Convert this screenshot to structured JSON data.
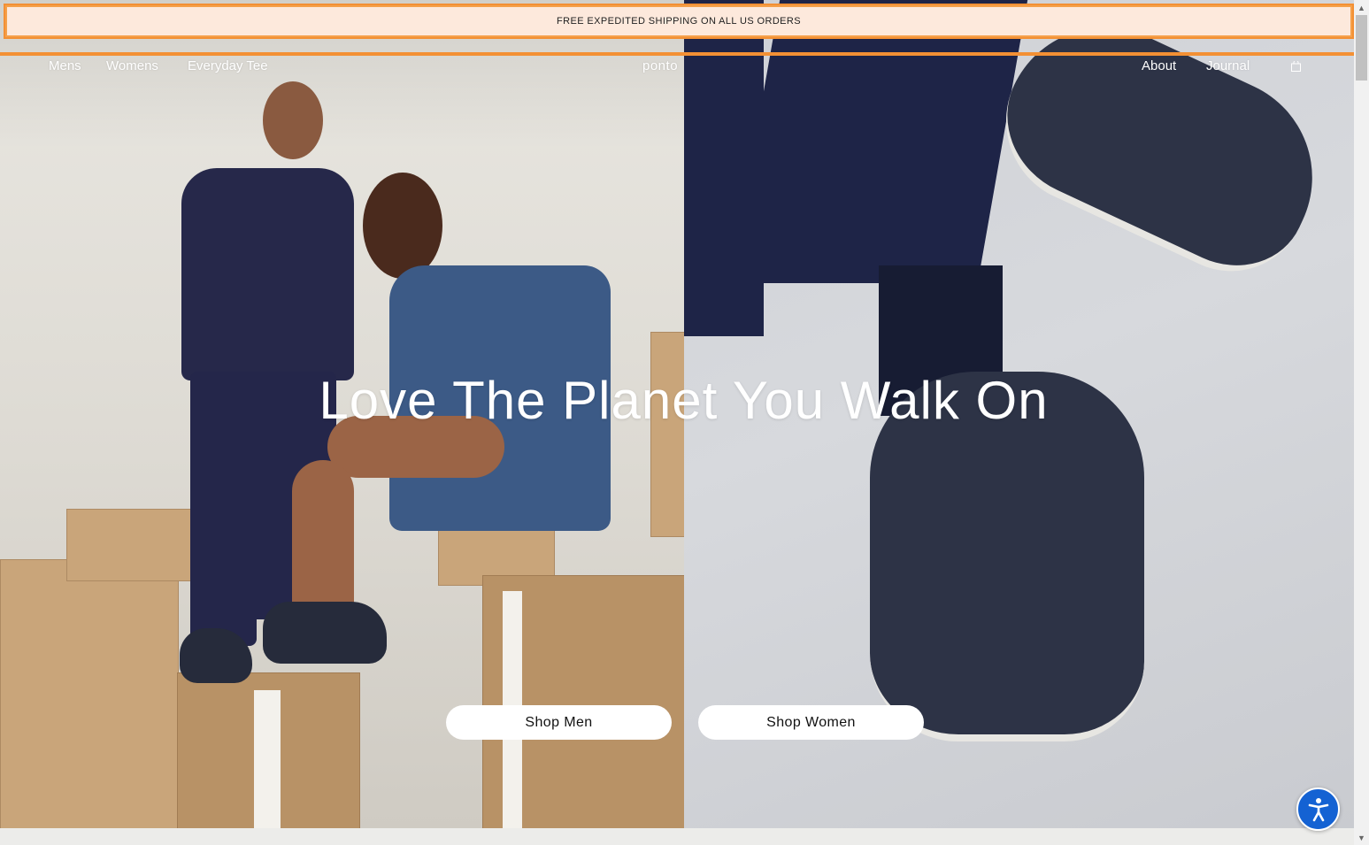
{
  "announcement": {
    "text": "FREE EXPEDITED SHIPPING ON ALL US ORDERS"
  },
  "header": {
    "nav_left": [
      "Mens",
      "Womens",
      "Everyday Tee"
    ],
    "logo": "ponto",
    "nav_right": [
      "About",
      "Journal"
    ],
    "cart_icon": "shopping-bag-icon"
  },
  "hero": {
    "headline": "Love The Planet You Walk On",
    "buttons": {
      "men": "Shop Men",
      "women": "Shop Women"
    }
  },
  "accessibility": {
    "icon": "accessibility-icon"
  },
  "colors": {
    "announcement_bg": "#fde9dc",
    "announcement_border": "#f39034",
    "cta_bg": "#ffffff",
    "a11y_blue": "#1462d3"
  }
}
